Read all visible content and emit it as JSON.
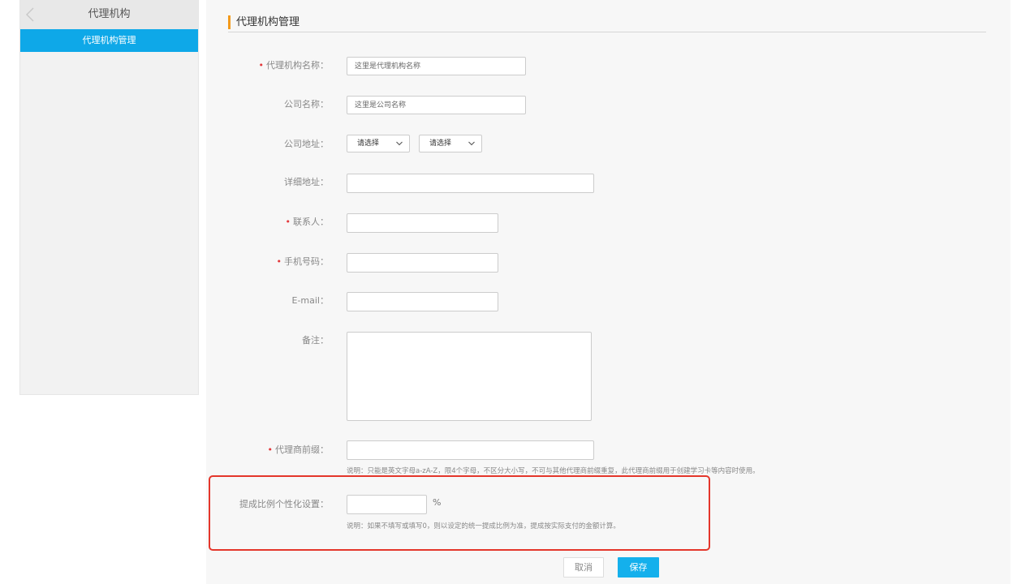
{
  "sidebar": {
    "title": "代理机构",
    "items": [
      {
        "label": "代理机构管理",
        "active": true
      }
    ]
  },
  "page": {
    "title": "代理机构管理"
  },
  "form": {
    "agency_name": {
      "label": "代理机构名称：",
      "required": true,
      "value": "",
      "placeholder": "这里是代理机构名称"
    },
    "company_name": {
      "label": "公司名称：",
      "required": false,
      "value": "",
      "placeholder": "这里是公司名称"
    },
    "company_address": {
      "label": "公司地址：",
      "province": "请选择",
      "city": "请选择"
    },
    "detail_address": {
      "label": "详细地址：",
      "value": ""
    },
    "contact": {
      "label": "联系人：",
      "required": true,
      "value": ""
    },
    "phone": {
      "label": "手机号码：",
      "required": true,
      "value": ""
    },
    "email": {
      "label": "E-mail：",
      "value": ""
    },
    "remark": {
      "label": "备注：",
      "value": ""
    },
    "prefix": {
      "label": "代理商前缀：",
      "required": true,
      "value": "",
      "hint": "说明：只能是英文字母a-zA-Z，限4个字母，不区分大小写，不可与其他代理商前缀重复，此代理商前缀用于创建学习卡等内容时使用。"
    },
    "commission": {
      "label": "提成比例个性化设置：",
      "value": "",
      "unit": "%",
      "hint": "说明：如果不填写或填写0，则以设定的统一提成比例为准，提成按实际支付的金额计算。"
    }
  },
  "actions": {
    "cancel": "取消",
    "save": "保存"
  },
  "colors": {
    "accent": "#14b0ec",
    "title_bar": "#f39a1c",
    "required": "#e3393c",
    "highlight": "#e4362b"
  }
}
